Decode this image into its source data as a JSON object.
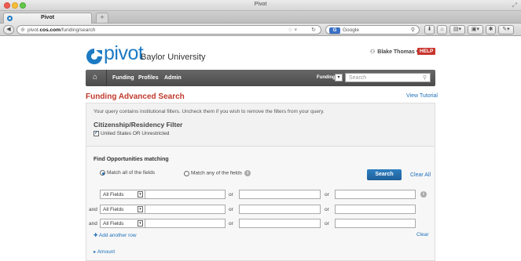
{
  "browser": {
    "window_title": "Pivot",
    "tab_title": "Pivot",
    "new_tab_label": "+",
    "url_prefix": "pivot.",
    "url_domain": "cos.com",
    "url_path": "/funding/search",
    "search_engine_label": "G",
    "search_placeholder": "Google"
  },
  "header": {
    "logo_text": "pivot",
    "institution": "Baylor University",
    "user_name": "Blake Thomas",
    "help_label": "HELP"
  },
  "nav": {
    "items": [
      "Funding",
      "Profiles",
      "Admin"
    ],
    "scope_label": "Funding",
    "search_placeholder": "Search"
  },
  "page": {
    "title": "Funding Advanced Search",
    "view_tutorial": "View Tutorial"
  },
  "filters": {
    "note": "Your query contains institutional filters. Uncheck them if you wish to remove the filters from your query.",
    "heading": "Citizenship/Residency Filter",
    "checkbox_label": "United States OR Unrestricted",
    "checkbox_checked": true
  },
  "find": {
    "heading": "Find Opportunities matching",
    "match_all_label": "Match all of the fields",
    "match_any_label": "Match any of the fields",
    "search_button": "Search",
    "clear_all": "Clear All",
    "rows": [
      {
        "conj": "",
        "field": "All Fields",
        "or1": "or",
        "or2": "or"
      },
      {
        "conj": "and",
        "field": "All Fields",
        "or1": "or",
        "or2": "or"
      },
      {
        "conj": "and",
        "field": "All Fields",
        "or1": "or",
        "or2": "or"
      }
    ],
    "add_row": "Add another row",
    "clear": "Clear",
    "amount": "Amount"
  },
  "colors": {
    "brand_blue": "#1c7ac4",
    "title_red": "#c0392b",
    "help_red": "#c8352d",
    "link_blue": "#1c6fb7"
  }
}
